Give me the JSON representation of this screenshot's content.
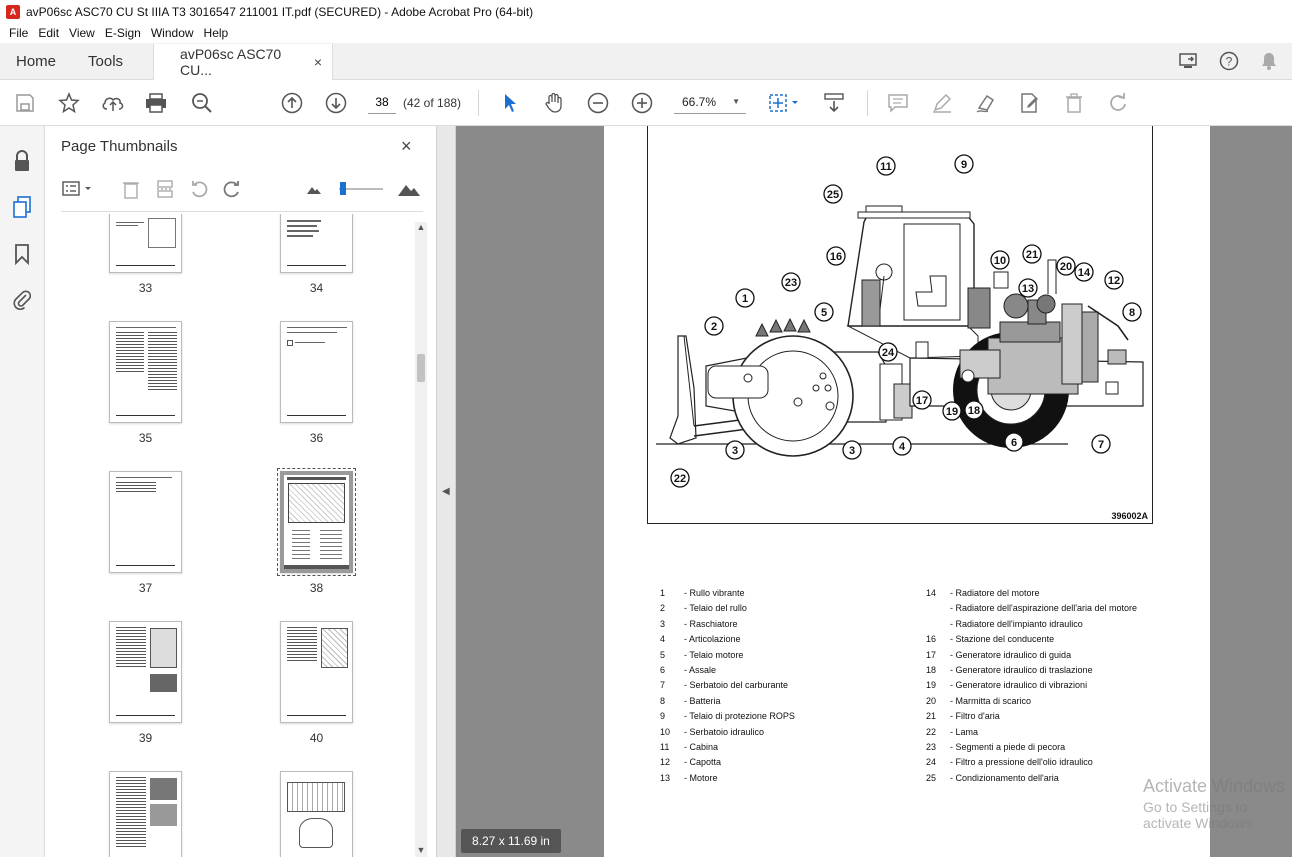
{
  "window": {
    "title": "avP06sc ASC70 CU St IIIA T3 3016547 211001 IT.pdf (SECURED) - Adobe Acrobat Pro (64-bit)"
  },
  "menu": [
    "File",
    "Edit",
    "View",
    "E-Sign",
    "Window",
    "Help"
  ],
  "tabs": {
    "home": "Home",
    "tools": "Tools",
    "document": "avP06sc ASC70 CU...",
    "close": "×"
  },
  "toolbar": {
    "page_number": "38",
    "page_count": "(42 of 188)",
    "zoom": "66.7%"
  },
  "panel": {
    "title": "Page Thumbnails",
    "close": "×",
    "thumbnails": [
      {
        "label": "33"
      },
      {
        "label": "34"
      },
      {
        "label": "35"
      },
      {
        "label": "36"
      },
      {
        "label": "37"
      },
      {
        "label": "38"
      },
      {
        "label": "39"
      },
      {
        "label": "40"
      }
    ]
  },
  "figure": {
    "code": "396002A",
    "callouts": [
      "1",
      "2",
      "3",
      "3",
      "4",
      "5",
      "6",
      "7",
      "8",
      "9",
      "10",
      "11",
      "12",
      "13",
      "14",
      "16",
      "17",
      "18",
      "19",
      "20",
      "21",
      "22",
      "23",
      "24",
      "25"
    ]
  },
  "legend": {
    "left": [
      {
        "num": "1",
        "text": "- Rullo vibrante"
      },
      {
        "num": "2",
        "text": "- Telaio del rullo"
      },
      {
        "num": "3",
        "text": "- Raschiatore"
      },
      {
        "num": "4",
        "text": "- Articolazione"
      },
      {
        "num": "5",
        "text": "- Telaio motore"
      },
      {
        "num": "6",
        "text": "- Assale"
      },
      {
        "num": "7",
        "text": "- Serbatoio del carburante"
      },
      {
        "num": "8",
        "text": "- Batteria"
      },
      {
        "num": "9",
        "text": "- Telaio di protezione ROPS"
      },
      {
        "num": "10",
        "text": "- Serbatoio idraulico"
      },
      {
        "num": "11",
        "text": "- Cabina"
      },
      {
        "num": "12",
        "text": "- Capotta"
      },
      {
        "num": "13",
        "text": "- Motore"
      }
    ],
    "right": [
      {
        "num": "14",
        "text": "- Radiatore del motore"
      },
      {
        "num": "",
        "text": "- Radiatore dell'aspirazione dell'aria del motore"
      },
      {
        "num": "",
        "text": "- Radiatore dell'impianto idraulico"
      },
      {
        "num": "16",
        "text": "- Stazione del conducente"
      },
      {
        "num": "17",
        "text": "- Generatore idraulico di guida"
      },
      {
        "num": "18",
        "text": "- Generatore idraulico di traslazione"
      },
      {
        "num": "19",
        "text": "- Generatore idraulico di vibrazioni"
      },
      {
        "num": "20",
        "text": "- Marmitta di scarico"
      },
      {
        "num": "21",
        "text": "- Filtro d'aria"
      },
      {
        "num": "22",
        "text": "- Lama"
      },
      {
        "num": "23",
        "text": "- Segmenti a piede di pecora"
      },
      {
        "num": "24",
        "text": "- Filtro a pressione dell'olio idraulico"
      },
      {
        "num": "25",
        "text": "- Condizionamento dell'aria"
      }
    ]
  },
  "status": {
    "page_size": "8.27 x 11.69 in"
  },
  "watermark": {
    "line1": "Activate Windows",
    "line2": "Go to Settings to activate Windows."
  }
}
